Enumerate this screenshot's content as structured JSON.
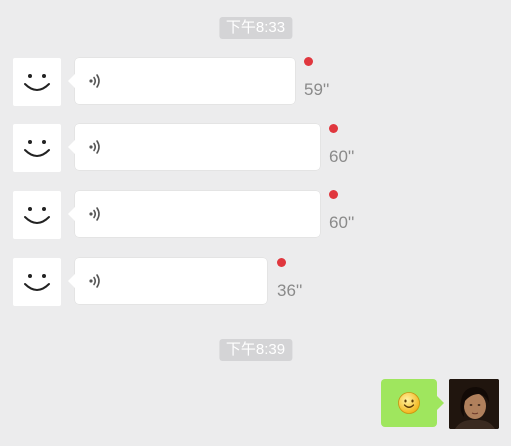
{
  "timestamps": [
    "下午8:33",
    "下午8:39"
  ],
  "voice_messages": [
    {
      "duration": "59''",
      "unread": true
    },
    {
      "duration": "60''",
      "unread": true
    },
    {
      "duration": "60''",
      "unread": true
    },
    {
      "duration": "36''",
      "unread": true
    }
  ],
  "colors": {
    "background": "#ececed",
    "timestamp_badge": "#d4d4d6",
    "unread_dot": "#e0373e",
    "sent_bubble": "#9fe65e"
  },
  "icons": {
    "contact_avatar": "smiley-face-icon",
    "voice": "voice-wave-icon",
    "sent_emoji": "smile-emoji-icon",
    "my_avatar": "user-photo"
  }
}
